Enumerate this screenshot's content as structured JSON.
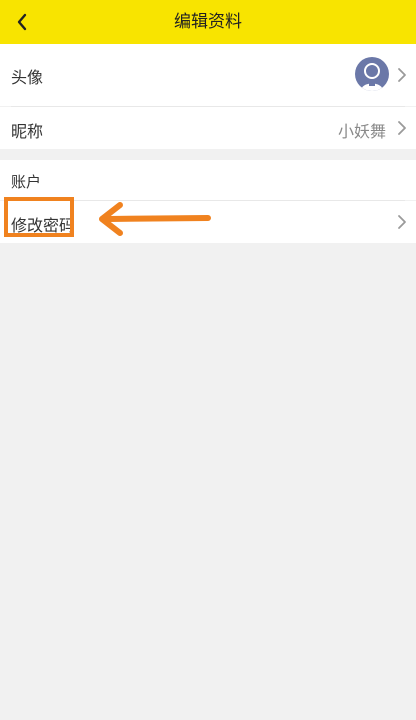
{
  "header": {
    "title": "编辑资料",
    "back_icon": "chevron-left-icon",
    "background": "#f8e400"
  },
  "profile": {
    "avatar_label": "头像",
    "avatar_icon": "user-avatar-icon",
    "nickname_label": "昵称",
    "nickname_value": "小妖舞"
  },
  "account": {
    "section_title": "账户",
    "change_password_label": "修改密码"
  },
  "annotation": {
    "color": "#f0821f",
    "arrow_icon": "arrow-left-icon"
  }
}
